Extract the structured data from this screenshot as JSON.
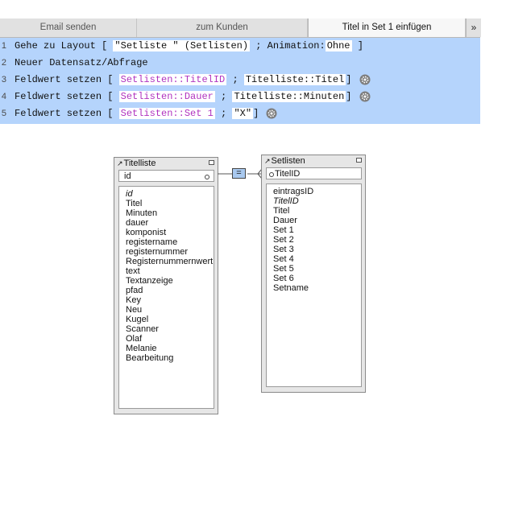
{
  "tabs": [
    {
      "label": "Email senden"
    },
    {
      "label": "zum Kunden"
    },
    {
      "label": "Titel in Set 1 einfügen"
    }
  ],
  "tabs_more": "»",
  "script_lines": [
    {
      "num": "1",
      "step": "Gehe zu Layout [",
      "a": "\"Setliste \" (Setlisten)",
      "sep": ";",
      "b_label": "Animation:",
      "b": "Ohne",
      "end": "]"
    },
    {
      "num": "2",
      "step": "Neuer Datensatz/Abfrage"
    },
    {
      "num": "3",
      "step": "Feldwert setzen [",
      "field": "Setlisten::TitelID",
      "sep": ";",
      "value": "Titelliste::Titel",
      "end": "]"
    },
    {
      "num": "4",
      "step": "Feldwert setzen [",
      "field": "Setlisten::Dauer",
      "sep": ";",
      "value": "Titelliste::Minuten",
      "end": "]"
    },
    {
      "num": "5",
      "step": "Feldwert setzen [",
      "field": "Setlisten::Set 1",
      "sep": ";",
      "value": "\"X\"",
      "end": "]"
    }
  ],
  "colors": {
    "selection": "#b5d4fc",
    "field_ref": "#b133bf"
  },
  "relationship": {
    "operator": "="
  },
  "titelliste": {
    "name": "Titelliste",
    "key": "id",
    "fields": [
      {
        "name": "id",
        "italic": true
      },
      {
        "name": "Titel"
      },
      {
        "name": "Minuten"
      },
      {
        "name": "dauer"
      },
      {
        "name": "komponist"
      },
      {
        "name": "registername"
      },
      {
        "name": "registernummer"
      },
      {
        "name": "Registernummernwert"
      },
      {
        "name": "text"
      },
      {
        "name": "Textanzeige"
      },
      {
        "name": "pfad"
      },
      {
        "name": "Key"
      },
      {
        "name": "Neu"
      },
      {
        "name": "Kugel"
      },
      {
        "name": "Scanner"
      },
      {
        "name": "Olaf"
      },
      {
        "name": "Melanie"
      },
      {
        "name": "Bearbeitung"
      }
    ]
  },
  "setlisten": {
    "name": "Setlisten",
    "key": "TitelID",
    "fields": [
      {
        "name": "eintragsID"
      },
      {
        "name": "TitelID",
        "italic": true
      },
      {
        "name": "Titel"
      },
      {
        "name": "Dauer"
      },
      {
        "name": "Set 1"
      },
      {
        "name": "Set 2"
      },
      {
        "name": "Set 3"
      },
      {
        "name": "Set 4"
      },
      {
        "name": "Set 5"
      },
      {
        "name": "Set 6"
      },
      {
        "name": "Setname"
      }
    ]
  }
}
